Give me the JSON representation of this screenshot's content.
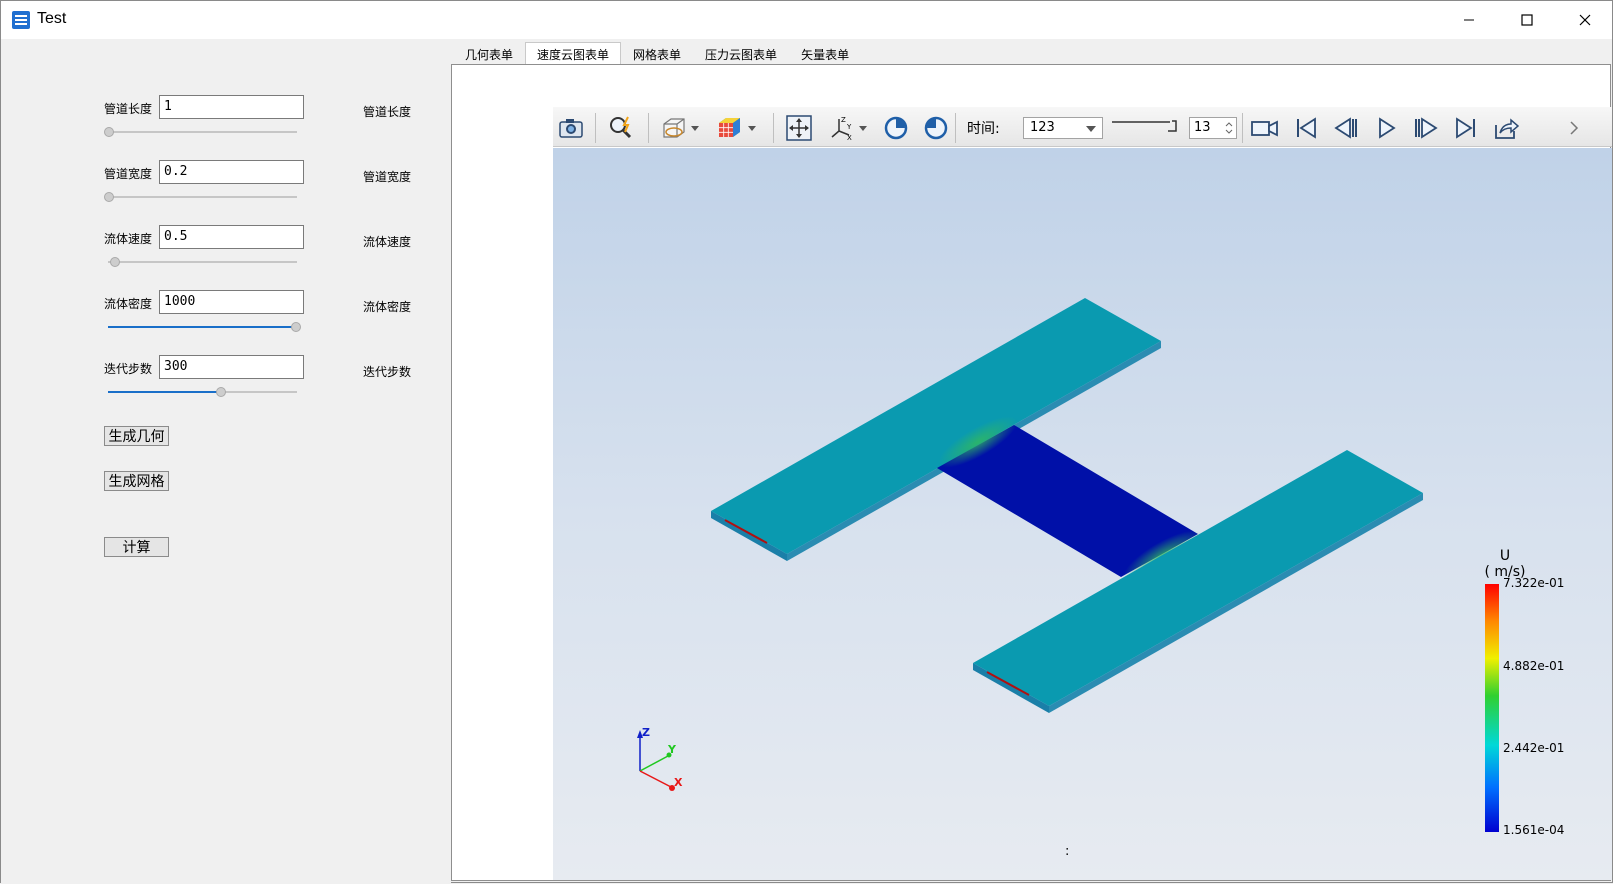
{
  "window": {
    "title": "Test"
  },
  "params": [
    {
      "label": "管道长度",
      "value": "1",
      "side_label": "管道长度",
      "slider_fraction": 0.0
    },
    {
      "label": "管道宽度",
      "value": "0.2",
      "side_label": "管道宽度",
      "slider_fraction": 0.0
    },
    {
      "label": "流体速度",
      "value": "0.5",
      "side_label": "流体速度",
      "slider_fraction": 0.03
    },
    {
      "label": "流体密度",
      "value": "1000",
      "side_label": "流体密度",
      "slider_fraction": 1.0
    },
    {
      "label": "迭代步数",
      "value": "300",
      "side_label": "迭代步数",
      "slider_fraction": 0.6
    }
  ],
  "buttons": {
    "gen_geometry": "生成几何",
    "gen_mesh": "生成网格",
    "compute": "计算"
  },
  "tabs": [
    {
      "label": "几何表单",
      "active": false
    },
    {
      "label": "速度云图表单",
      "active": true
    },
    {
      "label": "网格表单",
      "active": false
    },
    {
      "label": "压力云图表单",
      "active": false
    },
    {
      "label": "矢量表单",
      "active": false
    }
  ],
  "toolbar": {
    "time_label": "时间:",
    "time_value": "123",
    "step_value": "13",
    "icons": [
      "camera-icon",
      "zoom-icon",
      "display-mode-icon",
      "color-cube-icon",
      "fit-view-icon",
      "axes-icon",
      "rotate-cw-icon",
      "rotate-ccw-icon",
      "record-icon",
      "first-frame-icon",
      "prev-frame-icon",
      "play-icon",
      "next-frame-icon",
      "last-frame-icon",
      "export-icon"
    ]
  },
  "legend": {
    "title_line1": "U",
    "title_line2": "( m/s)",
    "max": "7.322e-01",
    "mid_high": "4.882e-01",
    "mid_low": "2.442e-01",
    "min": "1.561e-04"
  },
  "axes": {
    "x": "X",
    "y": "Y",
    "z": "Z"
  },
  "status": ":",
  "colors": {
    "accent": "#1a6fc9",
    "viewport_top": "#c0d2e8",
    "viewport_bottom": "#e7ebf1"
  }
}
